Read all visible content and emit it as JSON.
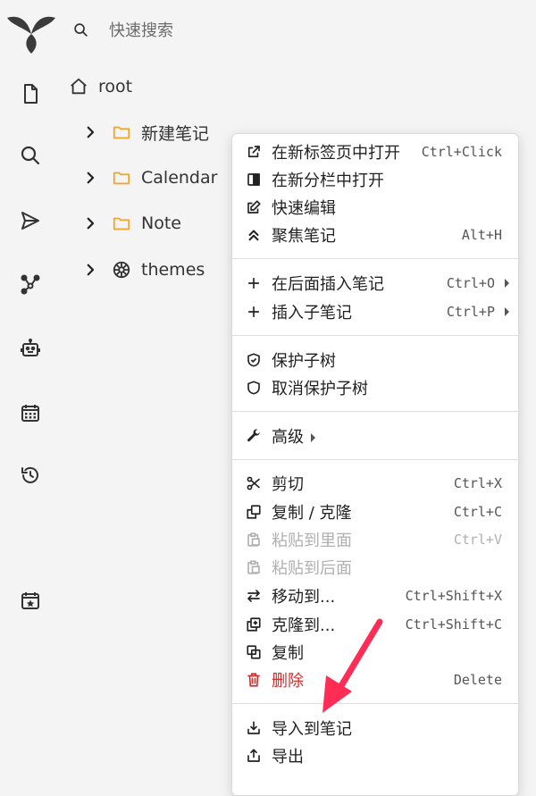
{
  "app": {
    "logo": "trilium-leaf-logo"
  },
  "search": {
    "label": "快速搜索",
    "icon": "search-icon"
  },
  "sidebar": {
    "items": [
      {
        "name": "new-note",
        "icon": "file-icon"
      },
      {
        "name": "search",
        "icon": "search-icon"
      },
      {
        "name": "jump-to",
        "icon": "send-icon"
      },
      {
        "name": "note-map",
        "icon": "graph-icon"
      },
      {
        "name": "llm",
        "icon": "robot-icon"
      },
      {
        "name": "calendar",
        "icon": "calendar-icon"
      },
      {
        "name": "recent",
        "icon": "history-icon"
      },
      {
        "name": "today",
        "icon": "calendar-star-icon"
      }
    ]
  },
  "tree": {
    "root": {
      "label": "root",
      "icon": "home-icon"
    },
    "items": [
      {
        "label": "新建笔记",
        "icon": "folder-icon"
      },
      {
        "label": "Calendar",
        "icon": "folder-icon"
      },
      {
        "label": "Note",
        "icon": "folder-icon"
      },
      {
        "label": "themes",
        "icon": "palette-icon"
      }
    ]
  },
  "menu": {
    "items": [
      {
        "label": "在新标签页中打开",
        "key": "Ctrl+Click",
        "icon": "external-link-icon"
      },
      {
        "label": "在新分栏中打开",
        "key": "",
        "icon": "split-pane-icon"
      },
      {
        "label": "快速编辑",
        "key": "",
        "icon": "edit-icon"
      },
      {
        "label": "聚焦笔记",
        "key": "Alt+H",
        "icon": "chevrons-up-icon"
      },
      {
        "label": "在后面插入笔记",
        "key": "Ctrl+O",
        "icon": "plus-icon"
      },
      {
        "label": "插入子笔记",
        "key": "Ctrl+P",
        "icon": "plus-icon"
      },
      {
        "label": "保护子树",
        "key": "",
        "icon": "shield-check-icon"
      },
      {
        "label": "取消保护子树",
        "key": "",
        "icon": "shield-icon"
      },
      {
        "label": "高级",
        "key": "",
        "icon": "wrench-icon"
      },
      {
        "label": "剪切",
        "key": "Ctrl+X",
        "icon": "scissors-icon"
      },
      {
        "label": "复制 / 克隆",
        "key": "Ctrl+C",
        "icon": "copy-icon"
      },
      {
        "label": "粘贴到里面",
        "key": "Ctrl+V",
        "icon": "paste-icon"
      },
      {
        "label": "粘贴到后面",
        "key": "",
        "icon": "paste-icon"
      },
      {
        "label": "移动到...",
        "key": "Ctrl+Shift+X",
        "icon": "swap-arrows-icon"
      },
      {
        "label": "克隆到...",
        "key": "Ctrl+Shift+C",
        "icon": "clone-plus-icon"
      },
      {
        "label": "复制",
        "key": "",
        "icon": "duplicate-icon"
      },
      {
        "label": "删除",
        "key": "Delete",
        "icon": "trash-icon"
      },
      {
        "label": "导入到笔记",
        "key": "",
        "icon": "import-icon"
      },
      {
        "label": "导出",
        "key": "",
        "icon": "export-icon"
      }
    ]
  },
  "colors": {
    "folder": "#f0a732",
    "danger": "#d32f2f",
    "annotation_arrow": "#ff2d55"
  }
}
